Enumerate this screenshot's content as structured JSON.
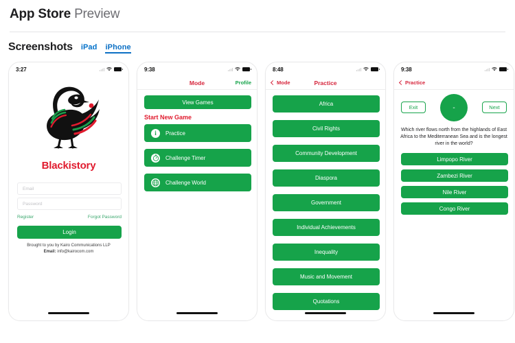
{
  "header": {
    "title_bold": "App Store",
    "title_light": "Preview"
  },
  "screenshots_section": {
    "heading": "Screenshots",
    "tabs": [
      {
        "label": "iPad",
        "active": false
      },
      {
        "label": "iPhone",
        "active": true
      }
    ]
  },
  "colors": {
    "green": "#16a34a",
    "red": "#e01b2e",
    "link_blue": "#0b6fc4",
    "nav_red": "#d6263c"
  },
  "phones": [
    {
      "status": {
        "time": "3:27"
      },
      "brand": "Blackistory",
      "fields": [
        {
          "placeholder": "Email"
        },
        {
          "placeholder": "Password"
        }
      ],
      "links": {
        "register": "Register",
        "forgot": "Forgot Password"
      },
      "login_label": "Login",
      "credit_line1": "Brought to you by Kairo Communications LLP",
      "credit_line2_label": "Email:",
      "credit_line2_value": "info@kairocom.com"
    },
    {
      "status": {
        "time": "9:38"
      },
      "nav": {
        "title": "Mode",
        "right": "Profile"
      },
      "view_games_label": "View Games",
      "section_label": "Start New Game",
      "modes": [
        {
          "label": "Practice",
          "icon": "info-icon"
        },
        {
          "label": "Challenge Timer",
          "icon": "stopwatch-icon"
        },
        {
          "label": "Challenge World",
          "icon": "globe-icon"
        }
      ]
    },
    {
      "status": {
        "time": "8:48"
      },
      "nav": {
        "back": "Mode",
        "title": "Practice"
      },
      "categories": [
        "Africa",
        "Civil Rights",
        "Community Development",
        "Diaspora",
        "Government",
        "Individual Achievements",
        "Inequality",
        "Music and Movement",
        "Quotations"
      ]
    },
    {
      "status": {
        "time": "9:38"
      },
      "nav": {
        "back": "Practice"
      },
      "exit_label": "Exit",
      "next_label": "Next",
      "score": "-",
      "question": "Which river flows north from the highlands of East Africa to the Mediterranean Sea and is the longest river in the world?",
      "answers": [
        "Limpopo River",
        "Zambezi River",
        "Nile River",
        "Congo River"
      ]
    }
  ]
}
